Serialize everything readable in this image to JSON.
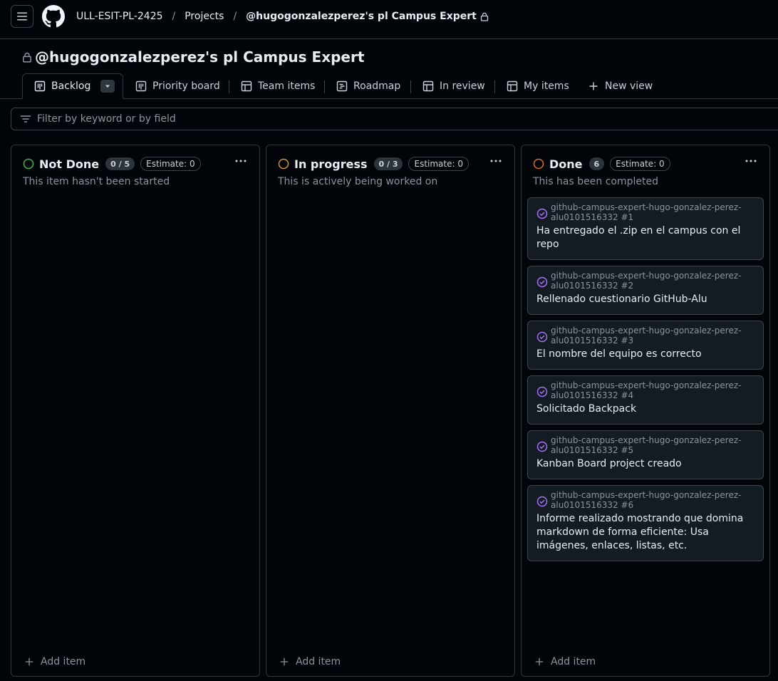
{
  "header": {
    "breadcrumbs": [
      "ULL-ESIT-PL-2425",
      "Projects",
      "@hugogonzalezperez's pl Campus Expert"
    ],
    "separator": "/"
  },
  "project": {
    "title": "@hugogonzalezperez's pl Campus Expert"
  },
  "tabs": [
    {
      "label": "Backlog",
      "icon": "board-icon",
      "active": true
    },
    {
      "label": "Priority board",
      "icon": "board-icon"
    },
    {
      "label": "Team items",
      "icon": "table-icon"
    },
    {
      "label": "Roadmap",
      "icon": "roadmap-icon"
    },
    {
      "label": "In review",
      "icon": "table-icon"
    },
    {
      "label": "My items",
      "icon": "table-icon"
    },
    {
      "label": "New view",
      "icon": "plus-icon"
    }
  ],
  "filter": {
    "placeholder": "Filter by keyword or by field"
  },
  "colors": {
    "not_done": "#3fb950",
    "in_progress": "#d29922",
    "done": "#db6d28",
    "issue_closed": "#a371f7"
  },
  "columns": [
    {
      "name": "Not Done",
      "count": "0 / 5",
      "estimate": "Estimate: 0",
      "description": "This item hasn't been started",
      "add_label": "Add item",
      "cards": []
    },
    {
      "name": "In progress",
      "count": "0 / 3",
      "estimate": "Estimate: 0",
      "description": "This is actively being worked on",
      "add_label": "Add item",
      "cards": []
    },
    {
      "name": "Done",
      "count": "6",
      "estimate": "Estimate: 0",
      "description": "This has been completed",
      "add_label": "Add item",
      "cards": [
        {
          "repo": "github-campus-expert-hugo-gonzalez-perez-alu0101516332 #1",
          "title": "Ha entregado el .zip en el campus con el repo"
        },
        {
          "repo": "github-campus-expert-hugo-gonzalez-perez-alu0101516332 #2",
          "title": "Rellenado cuestionario GitHub-Alu"
        },
        {
          "repo": "github-campus-expert-hugo-gonzalez-perez-alu0101516332 #3",
          "title": "El nombre del equipo es correcto"
        },
        {
          "repo": "github-campus-expert-hugo-gonzalez-perez-alu0101516332 #4",
          "title": "Solicitado Backpack"
        },
        {
          "repo": "github-campus-expert-hugo-gonzalez-perez-alu0101516332 #5",
          "title": "Kanban Board project creado"
        },
        {
          "repo": "github-campus-expert-hugo-gonzalez-perez-alu0101516332 #6",
          "title": "Informe realizado mostrando que domina markdown de forma eficiente: Usa imágenes, enlaces, listas, etc."
        }
      ]
    }
  ]
}
